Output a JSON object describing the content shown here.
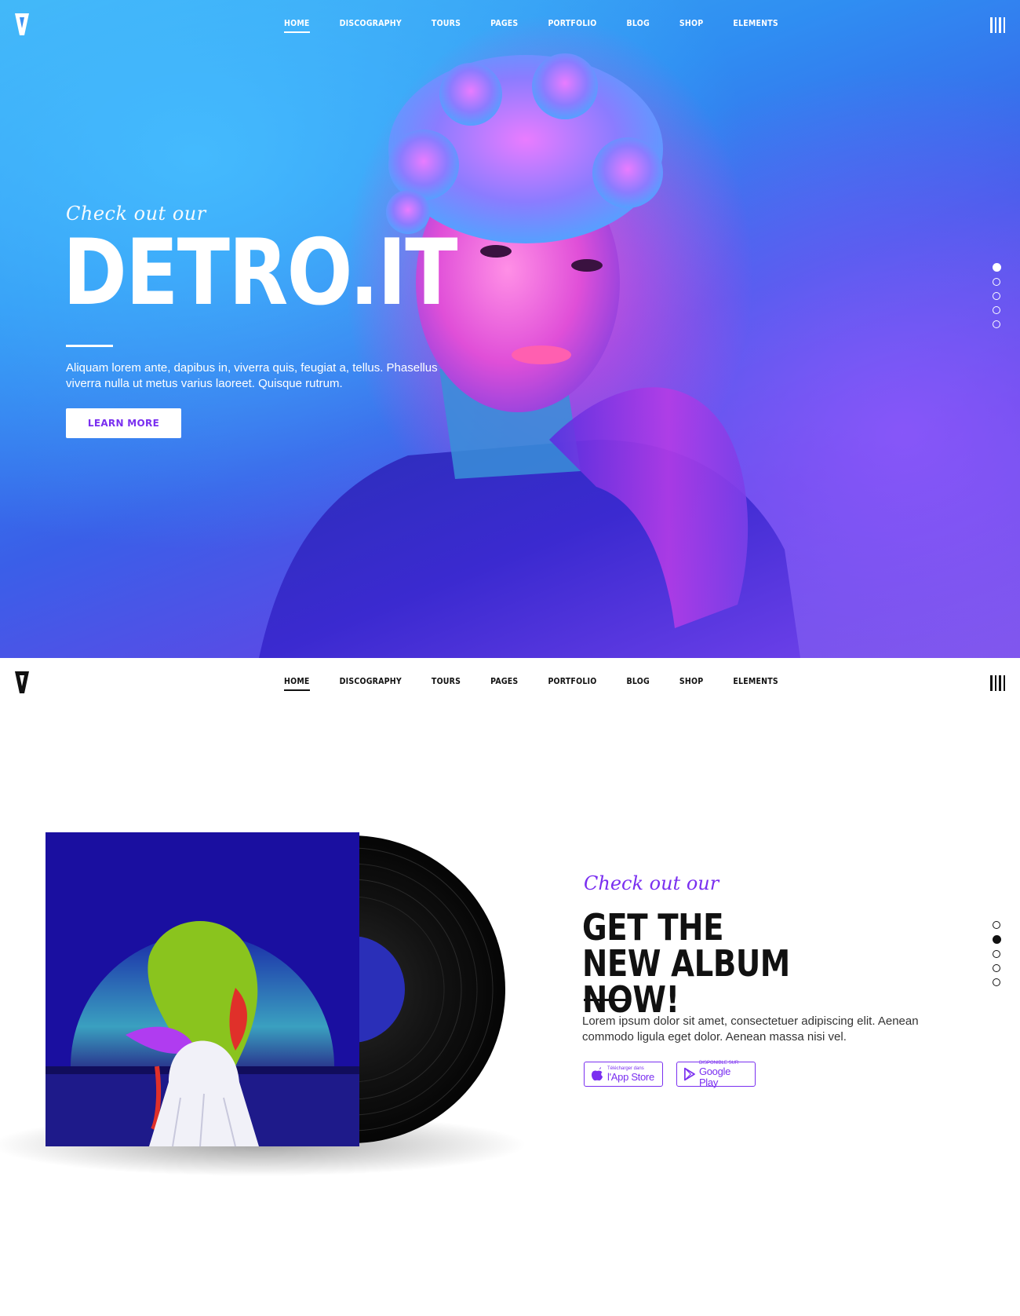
{
  "nav": {
    "items": [
      {
        "label": "HOME"
      },
      {
        "label": "DISCOGRAPHY"
      },
      {
        "label": "TOURS"
      },
      {
        "label": "PAGES"
      },
      {
        "label": "PORTFOLIO"
      },
      {
        "label": "BLOG"
      },
      {
        "label": "SHOP"
      },
      {
        "label": "ELEMENTS"
      }
    ],
    "active_index": 0,
    "logo_icon": "v-logo-icon",
    "menu_icon": "bars-menu-icon"
  },
  "hero": {
    "script_text": "Check out our",
    "title": "DETRO.IT",
    "description": "Aliquam lorem ante, dapibus in, viverra quis, feugiat a, tellus. Phasellus viverra nulla ut metus varius laoreet. Quisque rutrum.",
    "button_label": "LEARN MORE",
    "slide_count": 5,
    "active_slide": 0
  },
  "album": {
    "script_text": "Check out our",
    "title_line1": "GET THE",
    "title_line2": "NEW ALBUM NOW!",
    "description": "Lorem ipsum dolor sit amet, consectetuer adipiscing elit. Aenean commodo ligula eget dolor. Aenean massa nisi vel.",
    "app_store": {
      "small": "Télécharger dans",
      "big": "l'App Store",
      "icon": "apple-icon"
    },
    "google_play": {
      "small": "DISPONIBLE SUR",
      "big": "Google Play",
      "icon": "play-store-icon"
    },
    "slide_count": 5,
    "active_slide": 1
  },
  "colors": {
    "accent": "#7a2ff0",
    "dark": "#111111",
    "white": "#ffffff"
  }
}
